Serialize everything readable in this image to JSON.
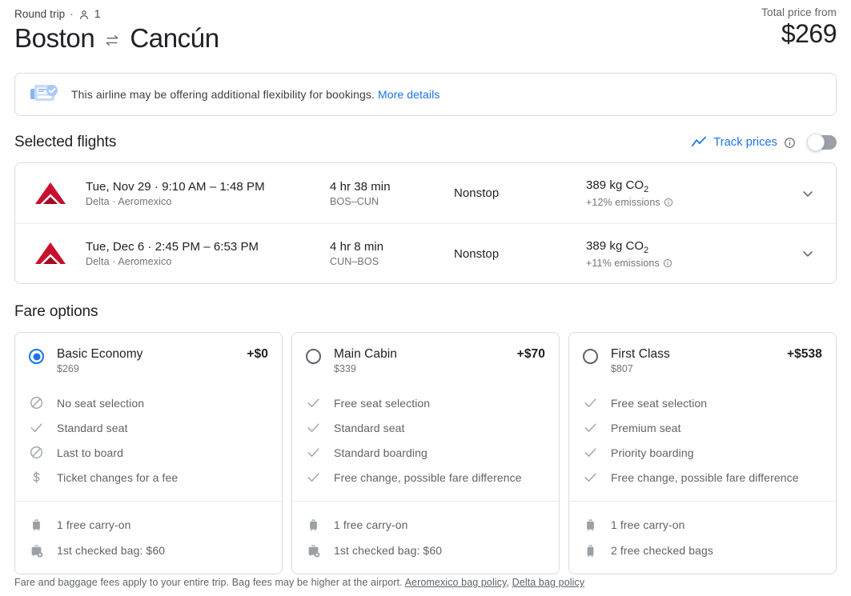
{
  "header": {
    "trip_type": "Round trip",
    "separator": "·",
    "passenger_icon": "person-icon",
    "passenger_count": "1",
    "origin": "Boston",
    "swap_icon": "swap-arrows-icon",
    "destination": "Cancún",
    "total_price_label": "Total price from",
    "total_price_value": "$269"
  },
  "banner": {
    "icon": "flexible-booking-ticket-icon",
    "text": "This airline may be offering additional flexibility for bookings.",
    "link_label": "More details"
  },
  "selected_flights": {
    "title": "Selected flights",
    "track_prices": {
      "trend_icon": "trending-up-icon",
      "label": "Track prices",
      "info_icon": "info-icon",
      "toggle_state": "off"
    },
    "flights": [
      {
        "airline_logo": "delta-logo-icon",
        "date": "Tue, Nov 29",
        "separator": "·",
        "times": "9:10 AM – 1:48 PM",
        "operators": "Delta · Aeromexico",
        "duration": "4 hr 38 min",
        "route": "BOS–CUN",
        "stops": "Nonstop",
        "emissions": "389 kg CO",
        "emissions_sub": "2",
        "emissions_delta": "+12% emissions",
        "info_icon": "info-icon",
        "expand_icon": "chevron-down-icon"
      },
      {
        "airline_logo": "delta-logo-icon",
        "date": "Tue, Dec 6",
        "separator": "·",
        "times": "2:45 PM – 6:53 PM",
        "operators": "Delta · Aeromexico",
        "duration": "4 hr 8 min",
        "route": "CUN–BOS",
        "stops": "Nonstop",
        "emissions": "389 kg CO",
        "emissions_sub": "2",
        "emissions_delta": "+11% emissions",
        "info_icon": "info-icon",
        "expand_icon": "chevron-down-icon"
      }
    ]
  },
  "fare_options": {
    "title": "Fare options",
    "cards": [
      {
        "selected": true,
        "name": "Basic Economy",
        "base_price": "$269",
        "delta_price": "+$0",
        "features": [
          {
            "icon": "block-icon",
            "label": "No seat selection"
          },
          {
            "icon": "check-icon",
            "label": "Standard seat"
          },
          {
            "icon": "block-icon",
            "label": "Last to board"
          },
          {
            "icon": "dollar-icon",
            "label": "Ticket changes for a fee"
          }
        ],
        "bags": [
          {
            "icon": "carry-on-bag-icon",
            "label": "1 free carry-on"
          },
          {
            "icon": "checked-bag-add-icon",
            "label": "1st checked bag: $60"
          }
        ]
      },
      {
        "selected": false,
        "name": "Main Cabin",
        "base_price": "$339",
        "delta_price": "+$70",
        "features": [
          {
            "icon": "check-icon",
            "label": "Free seat selection"
          },
          {
            "icon": "check-icon",
            "label": "Standard seat"
          },
          {
            "icon": "check-icon",
            "label": "Standard boarding"
          },
          {
            "icon": "check-icon",
            "label": "Free change, possible fare difference"
          }
        ],
        "bags": [
          {
            "icon": "carry-on-bag-icon",
            "label": "1 free carry-on"
          },
          {
            "icon": "checked-bag-add-icon",
            "label": "1st checked bag: $60"
          }
        ]
      },
      {
        "selected": false,
        "name": "First Class",
        "base_price": "$807",
        "delta_price": "+$538",
        "features": [
          {
            "icon": "check-icon",
            "label": "Free seat selection"
          },
          {
            "icon": "check-icon",
            "label": "Premium seat"
          },
          {
            "icon": "check-icon",
            "label": "Priority boarding"
          },
          {
            "icon": "check-icon",
            "label": "Free change, possible fare difference"
          }
        ],
        "bags": [
          {
            "icon": "carry-on-bag-icon",
            "label": "1 free carry-on"
          },
          {
            "icon": "checked-bag-icon",
            "label": "2 free checked bags"
          }
        ]
      }
    ]
  },
  "footer": {
    "text": "Fare and baggage fees apply to your entire trip. Bag fees may be higher at the airport.",
    "link1": "Aeromexico bag policy",
    "comma": ",",
    "link2": "Delta bag policy"
  },
  "colors": {
    "accent_blue": "#1a73e8",
    "delta_red": "#c8102e",
    "text_primary": "#202124",
    "text_secondary": "#5f6368",
    "border": "#dadce0"
  }
}
